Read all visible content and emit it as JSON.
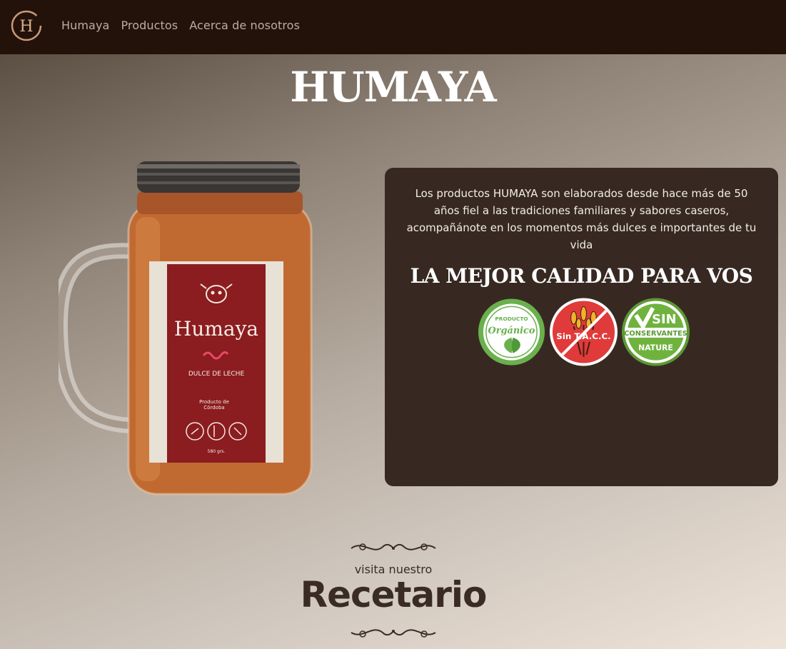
{
  "nav": {
    "logo_letter": "H",
    "links": [
      "Humaya",
      "Productos",
      "Acerca de nosotros"
    ]
  },
  "hero": {
    "title": "HUMAYA"
  },
  "product_label": {
    "brand": "Humaya",
    "product": "DULCE DE LECHE",
    "origin_line1": "Producto de",
    "origin_line2": "Córdoba",
    "weight": "580 grs."
  },
  "info": {
    "description": "Los productos HUMAYA son elaborados desde hace más de 50 años fiel a las tradiciones familiares y sabores caseros, acompañánote en los momentos más dulces e importantes de tu vida",
    "heading": "LA MEJOR CALIDAD PARA VOS",
    "badges": {
      "organic_top": "PRODUCTO",
      "organic_main": "Orgánico",
      "tacc": "Sin T.A.C.C.",
      "sin": "SIN",
      "conservantes": "CONSERVANTES",
      "nature": "NATURE"
    }
  },
  "recetario": {
    "subtitle": "visita nuestro",
    "title": "Recetario"
  },
  "colors": {
    "nav_bg": "#23120a",
    "panel_bg": "#372922",
    "label_red": "#8b1c20",
    "green": "#6ab04c",
    "tacc_red": "#e03a3a"
  }
}
